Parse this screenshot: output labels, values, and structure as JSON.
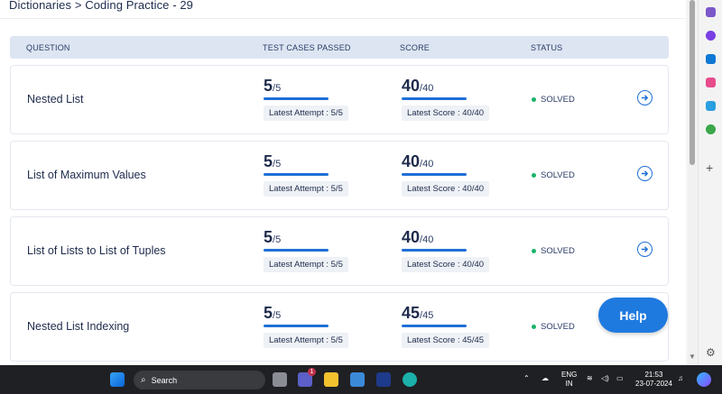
{
  "breadcrumb": "Dictionaries > Coding Practice - 29",
  "table": {
    "headers": {
      "question": "QUESTION",
      "tests": "TEST CASES PASSED",
      "score": "SCORE",
      "status": "STATUS"
    },
    "rows": [
      {
        "question": "Nested List",
        "tests_passed": "5",
        "tests_total": "/5",
        "tests_progress": 1.0,
        "latest_attempt": "Latest Attempt : 5/5",
        "score": "40",
        "score_total": "/40",
        "score_progress": 1.0,
        "latest_score": "Latest Score : 40/40",
        "status": "SOLVED"
      },
      {
        "question": "List of Maximum Values",
        "tests_passed": "5",
        "tests_total": "/5",
        "tests_progress": 1.0,
        "latest_attempt": "Latest Attempt : 5/5",
        "score": "40",
        "score_total": "/40",
        "score_progress": 1.0,
        "latest_score": "Latest Score : 40/40",
        "status": "SOLVED"
      },
      {
        "question": "List of Lists to List of Tuples",
        "tests_passed": "5",
        "tests_total": "/5",
        "tests_progress": 1.0,
        "latest_attempt": "Latest Attempt : 5/5",
        "score": "40",
        "score_total": "/40",
        "score_progress": 1.0,
        "latest_score": "Latest Score : 40/40",
        "status": "SOLVED"
      },
      {
        "question": "Nested List Indexing",
        "tests_passed": "5",
        "tests_total": "/5",
        "tests_progress": 1.0,
        "latest_attempt": "Latest Attempt : 5/5",
        "score": "45",
        "score_total": "/45",
        "score_progress": 1.0,
        "latest_score": "Latest Score : 45/45",
        "status": "SOLVED"
      }
    ]
  },
  "help_label": "Help",
  "colors": {
    "accent": "#1f6fd6",
    "solved": "#1bb36a",
    "header_bg": "#dde5f2"
  },
  "taskbar": {
    "search_label": "Search",
    "teams_badge": "1",
    "lang": "ENG",
    "region": "IN",
    "time": "21:53",
    "date": "23-07-2024"
  }
}
